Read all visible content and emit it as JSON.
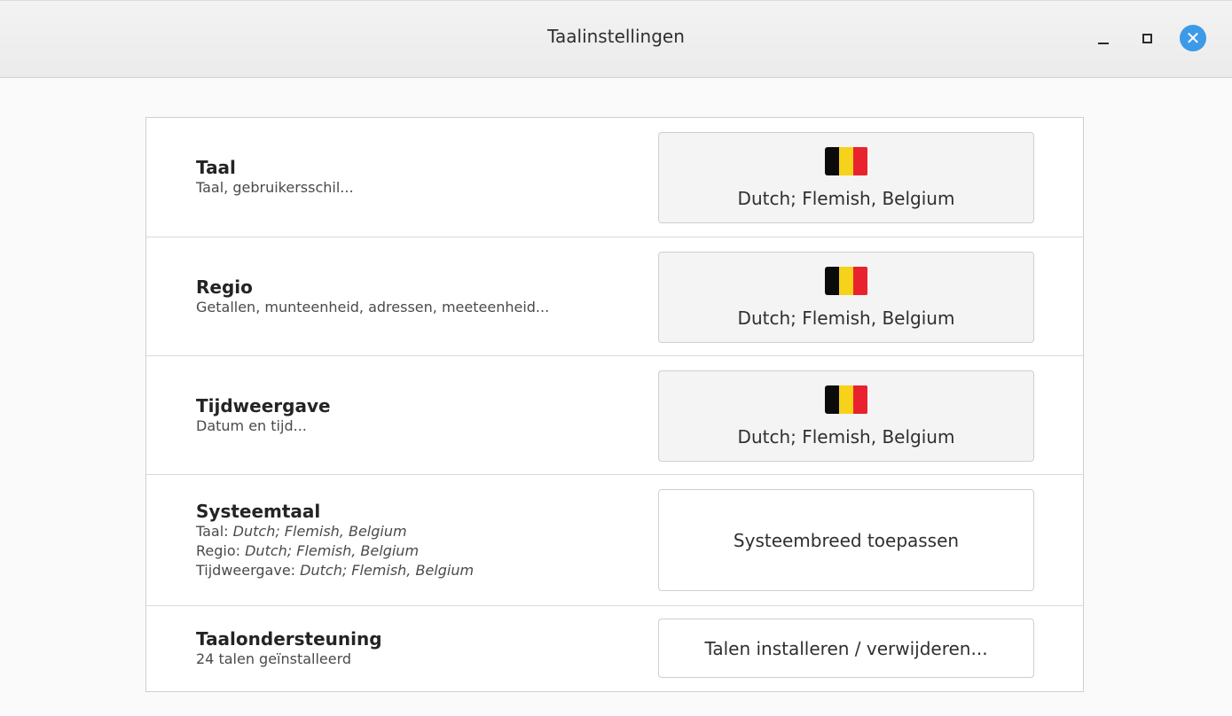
{
  "window": {
    "title": "Taalinstellingen",
    "controls": {
      "minimize_icon": "minimize-icon",
      "maximize_icon": "maximize-icon",
      "close_icon": "close-icon",
      "close_glyph": "✕"
    }
  },
  "rows": {
    "language": {
      "title": "Taal",
      "description": "Taal, gebruikersschil...",
      "button_label": "Dutch; Flemish, Belgium",
      "flag": "belgium-flag-icon"
    },
    "region": {
      "title": "Regio",
      "description": "Getallen, munteenheid, adressen, meeteenheid...",
      "button_label": "Dutch; Flemish, Belgium",
      "flag": "belgium-flag-icon"
    },
    "time_format": {
      "title": "Tijdweergave",
      "description": "Datum en tijd...",
      "button_label": "Dutch; Flemish, Belgium",
      "flag": "belgium-flag-icon"
    },
    "system_language": {
      "title": "Systeemtaal",
      "lines": [
        {
          "prefix": "Taal: ",
          "value": "Dutch; Flemish, Belgium"
        },
        {
          "prefix": "Regio: ",
          "value": "Dutch; Flemish, Belgium"
        },
        {
          "prefix": "Tijdweergave: ",
          "value": "Dutch; Flemish, Belgium"
        }
      ],
      "button_label": "Systeembreed toepassen"
    },
    "language_support": {
      "title": "Taalondersteuning",
      "description": "24 talen geïnstalleerd",
      "button_label": "Talen installeren / verwijderen..."
    }
  },
  "colors": {
    "flag_black": "#0b0b0b",
    "flag_yellow": "#f6d21b",
    "flag_red": "#e8232d",
    "close_blue": "#3d9ae8"
  }
}
